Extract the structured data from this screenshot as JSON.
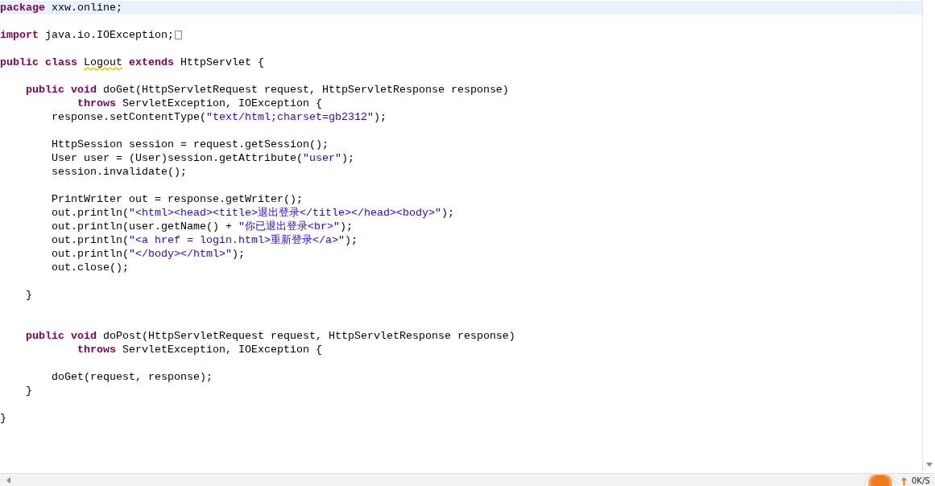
{
  "editor": {
    "lines": [
      {
        "current": true,
        "collapsed": false,
        "tokens": [
          {
            "kind": "keyword",
            "text": "package "
          },
          {
            "kind": "plain",
            "text": "xxw.online;"
          }
        ]
      },
      {
        "current": false,
        "collapsed": false
      },
      {
        "current": false,
        "collapsed": true,
        "tokens": [
          {
            "kind": "keyword",
            "text": "import "
          },
          {
            "kind": "plain",
            "text": "java.io.IOException;"
          }
        ]
      },
      {
        "current": false,
        "collapsed": false
      },
      {
        "current": false,
        "collapsed": false,
        "tokens": [
          {
            "kind": "keyword",
            "text": "public class "
          },
          {
            "kind": "warning",
            "text": "Logout"
          },
          {
            "kind": "keyword",
            "text": " extends "
          },
          {
            "kind": "plain",
            "text": "HttpServlet {"
          }
        ]
      },
      {
        "current": false,
        "collapsed": false
      },
      {
        "current": false,
        "collapsed": false,
        "tokens": [
          {
            "kind": "keyword",
            "text": "    public void "
          },
          {
            "kind": "plain",
            "text": "doGet(HttpServletRequest request, HttpServletResponse response)"
          }
        ]
      },
      {
        "current": false,
        "collapsed": false,
        "tokens": [
          {
            "kind": "keyword",
            "text": "            throws "
          },
          {
            "kind": "plain",
            "text": "ServletException, IOException {"
          }
        ]
      },
      {
        "current": false,
        "collapsed": false,
        "tokens": [
          {
            "kind": "plain",
            "text": "        response.setContentType("
          },
          {
            "kind": "string",
            "text": "\"text/html;charset=gb2312\""
          },
          {
            "kind": "plain",
            "text": ");"
          }
        ]
      },
      {
        "current": false,
        "collapsed": false
      },
      {
        "current": false,
        "collapsed": false,
        "tokens": [
          {
            "kind": "plain",
            "text": "        HttpSession session = request.getSession();"
          }
        ]
      },
      {
        "current": false,
        "collapsed": false,
        "tokens": [
          {
            "kind": "plain",
            "text": "        User user = (User)session.getAttribute("
          },
          {
            "kind": "string",
            "text": "\"user\""
          },
          {
            "kind": "plain",
            "text": ");"
          }
        ]
      },
      {
        "current": false,
        "collapsed": false,
        "tokens": [
          {
            "kind": "plain",
            "text": "        session.invalidate();"
          }
        ]
      },
      {
        "current": false,
        "collapsed": false
      },
      {
        "current": false,
        "collapsed": false,
        "tokens": [
          {
            "kind": "plain",
            "text": "        PrintWriter out = response.getWriter();"
          }
        ]
      },
      {
        "current": false,
        "collapsed": false,
        "tokens": [
          {
            "kind": "plain",
            "text": "        out.println("
          },
          {
            "kind": "string",
            "text": "\"<html><head><title>退出登录</title></head><body>\""
          },
          {
            "kind": "plain",
            "text": ");"
          }
        ]
      },
      {
        "current": false,
        "collapsed": false,
        "tokens": [
          {
            "kind": "plain",
            "text": "        out.println(user.getName() + "
          },
          {
            "kind": "string",
            "text": "\"你已退出登录<br>\""
          },
          {
            "kind": "plain",
            "text": ");"
          }
        ]
      },
      {
        "current": false,
        "collapsed": false,
        "tokens": [
          {
            "kind": "plain",
            "text": "        out.println("
          },
          {
            "kind": "string",
            "text": "\"<a href = login.html>重新登录</a>\""
          },
          {
            "kind": "plain",
            "text": ");"
          }
        ]
      },
      {
        "current": false,
        "collapsed": false,
        "tokens": [
          {
            "kind": "plain",
            "text": "        out.println("
          },
          {
            "kind": "string",
            "text": "\"</body></html>\""
          },
          {
            "kind": "plain",
            "text": ");"
          }
        ]
      },
      {
        "current": false,
        "collapsed": false,
        "tokens": [
          {
            "kind": "plain",
            "text": "        out.close();"
          }
        ]
      },
      {
        "current": false,
        "collapsed": false
      },
      {
        "current": false,
        "collapsed": false,
        "tokens": [
          {
            "kind": "plain",
            "text": "    }"
          }
        ]
      },
      {
        "current": false,
        "collapsed": false
      },
      {
        "current": false,
        "collapsed": false
      },
      {
        "current": false,
        "collapsed": false,
        "tokens": [
          {
            "kind": "keyword",
            "text": "    public void "
          },
          {
            "kind": "plain",
            "text": "doPost(HttpServletRequest request, HttpServletResponse response)"
          }
        ]
      },
      {
        "current": false,
        "collapsed": false,
        "tokens": [
          {
            "kind": "keyword",
            "text": "            throws "
          },
          {
            "kind": "plain",
            "text": "ServletException, IOException {"
          }
        ]
      },
      {
        "current": false,
        "collapsed": false
      },
      {
        "current": false,
        "collapsed": false,
        "tokens": [
          {
            "kind": "plain",
            "text": "        doGet(request, response);"
          }
        ]
      },
      {
        "current": false,
        "collapsed": false,
        "tokens": [
          {
            "kind": "plain",
            "text": "    }"
          }
        ]
      },
      {
        "current": false,
        "collapsed": false
      },
      {
        "current": false,
        "collapsed": false,
        "tokens": [
          {
            "kind": "plain",
            "text": "}"
          }
        ]
      }
    ]
  },
  "speed_widget": {
    "reading": "0K/S"
  }
}
